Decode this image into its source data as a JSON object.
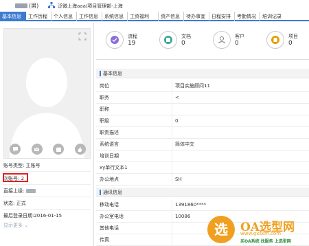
{
  "header": {
    "user_suffix": "(男)",
    "org_path": "泛微上海aaa/项目管理部-上海"
  },
  "tabs": [
    {
      "label": "基本信息",
      "active": true
    },
    {
      "label": "工作历程"
    },
    {
      "label": "个人信息"
    },
    {
      "label": "工作信息"
    },
    {
      "label": "系统信息"
    },
    {
      "label": "工资福利"
    },
    {
      "label": "资产信息"
    },
    {
      "label": "待办事宜"
    },
    {
      "label": "日程安排"
    },
    {
      "label": "考勤情况"
    },
    {
      "label": "培训记录"
    }
  ],
  "profile": {
    "account_type": "账号类型: 主账号",
    "sub_account": "次账号: 2",
    "supervisor_label": "直接上级:",
    "status": "状态: 正式",
    "last_login": "最后登录日期:2016-01-15",
    "show_more": "显示更多 ⌄",
    "action_icons": [
      "chat-icon",
      "mail-icon",
      "calendar-icon",
      "hand-icon"
    ]
  },
  "stats": [
    {
      "label": "流程",
      "value": "19",
      "icon": "workflow-icon"
    },
    {
      "label": "文档",
      "value": "0",
      "icon": "document-icon"
    },
    {
      "label": "客户",
      "value": "0",
      "icon": "customer-icon"
    },
    {
      "label": "项目",
      "value": "0",
      "icon": "project-icon"
    }
  ],
  "basic_info": {
    "title": "基本信息",
    "rows": [
      {
        "key": "岗位",
        "value": "项目实施顾问11"
      },
      {
        "key": "职务",
        "value": "<"
      },
      {
        "key": "职称",
        "value": ""
      },
      {
        "key": "职级",
        "value": "0"
      },
      {
        "key": "职责描述",
        "value": ""
      },
      {
        "key": "系统语言",
        "value": "简体中文"
      },
      {
        "key": "培训日期",
        "value": ""
      },
      {
        "key": "xy单行文本1",
        "value": ""
      },
      {
        "key": "办公地点",
        "value": "SH"
      }
    ]
  },
  "contact_info": {
    "title": "通讯信息",
    "rows": [
      {
        "key": "移动电话",
        "value": "1391860****"
      },
      {
        "key": "办公室电话",
        "value": "10086"
      },
      {
        "key": "其他电话",
        "value": ""
      },
      {
        "key": "传真",
        "value": ""
      }
    ]
  },
  "watermark": {
    "logo_char": "选",
    "title": "OA选型网",
    "url": "www.gxskm.com",
    "slogan": "买OA系统 找服务 上选型网"
  },
  "colors": {
    "accent": "#3d7bd0",
    "highlight_red": "#e02020",
    "watermark_orange": "#f0a020"
  }
}
